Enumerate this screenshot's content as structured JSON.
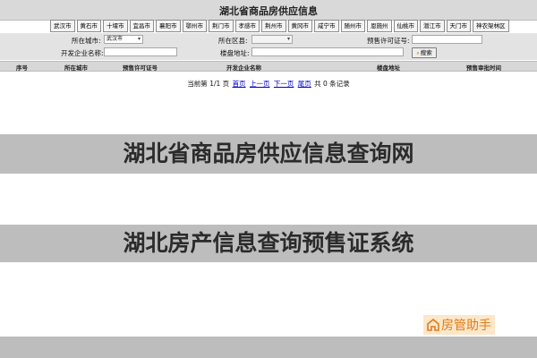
{
  "site": {
    "title": "湖北省商品房供应信息"
  },
  "cities": [
    "武汉市",
    "黄石市",
    "十堰市",
    "宜昌市",
    "襄阳市",
    "鄂州市",
    "荆门市",
    "孝感市",
    "荆州市",
    "黄冈市",
    "咸宁市",
    "随州市",
    "恩施州",
    "仙桃市",
    "潜江市",
    "天门市",
    "神农架林区"
  ],
  "form": {
    "city_label": "所在城市:",
    "city_value": "武汉市",
    "district_label": "所在区县:",
    "district_value": "",
    "permit_label": "预售许可证号:",
    "permit_value": "",
    "developer_label": "开发企业名称:",
    "developer_value": "",
    "address_label": "楼盘地址:",
    "address_value": "",
    "search_label": "搜索"
  },
  "table": {
    "headers": [
      "序号",
      "所在城市",
      "预售许可证号",
      "开发企业名称",
      "楼盘地址",
      "预售审批时间"
    ]
  },
  "pager": {
    "prefix": "当前第",
    "page": "1/1",
    "page_unit": "页",
    "first": "首页",
    "prev": "上一页",
    "next": "下一页",
    "last": "尾页",
    "total": "共 0 条记录"
  },
  "banners": {
    "one": "湖北省商品房供应信息查询网",
    "two": "湖北房产信息查询预售证系统"
  },
  "brand": {
    "text": "房管助手"
  },
  "colors": {
    "banner_bg": "#bdbdbd",
    "link": "#0000cc",
    "brand": "#e07b1a",
    "brand_bg": "#fde7c9"
  }
}
